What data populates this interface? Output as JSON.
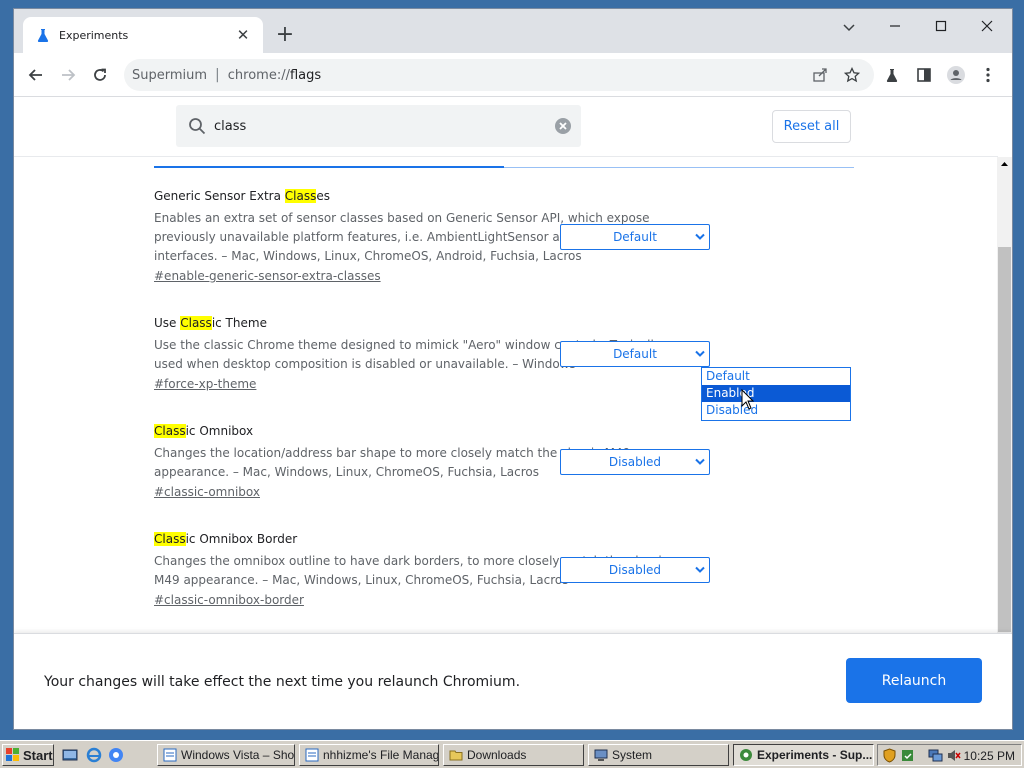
{
  "browser": {
    "tab_title": "Experiments",
    "tab_close": "✕",
    "new_tab": "+",
    "site_chip": "Supermium",
    "url_prefix": "chrome://",
    "url_path": "flags"
  },
  "flags_page": {
    "search_value": "class",
    "reset_label": "Reset all",
    "flags": [
      {
        "name_pre": "Generic Sensor Extra ",
        "name_hl": "Class",
        "name_post": "es",
        "description": "Enables an extra set of sensor classes based on Generic Sensor API, which expose previously unavailable platform features, i.e. AmbientLightSensor and Magnetometer interfaces. – Mac, Windows, Linux, ChromeOS, Android, Fuchsia, Lacros",
        "link": "#enable-generic-sensor-extra-classes",
        "selected": "Default"
      },
      {
        "name_pre": "Use ",
        "name_hl": "Class",
        "name_post": "ic Theme",
        "description": "Use the classic Chrome theme designed to mimick \"Aero\" window controls. Typically used when desktop composition is disabled or unavailable. – Windows",
        "link": "#force-xp-theme",
        "selected": "Default"
      },
      {
        "name_pre": "",
        "name_hl": "Class",
        "name_post": "ic Omnibox",
        "description": "Changes the location/address bar shape to more closely match the classic M49 appearance. – Mac, Windows, Linux, ChromeOS, Fuchsia, Lacros",
        "link": "#classic-omnibox",
        "selected": "Disabled"
      },
      {
        "name_pre": "",
        "name_hl": "Class",
        "name_post": "ic Omnibox Border",
        "description": "Changes the omnibox outline to have dark borders, to more closely match the classic M49 appearance. – Mac, Windows, Linux, ChromeOS, Fuchsia, Lacros",
        "link": "#classic-omnibox-border",
        "selected": "Disabled"
      }
    ],
    "dropdown_options": [
      "Default",
      "Enabled",
      "Disabled"
    ],
    "dropdown_highlighted": "Enabled"
  },
  "footer": {
    "message": "Your changes will take effect the next time you relaunch Chromium.",
    "relaunch_label": "Relaunch"
  },
  "taskbar": {
    "start_label": "Start",
    "tasks": [
      "Windows Vista – Sho...",
      "nhhizme's File Manag...",
      "Downloads",
      "System",
      "Experiments - Sup..."
    ],
    "clock": "10:25 PM"
  },
  "colors": {
    "accent": "#1a73e8",
    "highlight": "#ffff00",
    "desktop": "#3a6ea5",
    "dropdown_selected": "#0b5ad5"
  }
}
